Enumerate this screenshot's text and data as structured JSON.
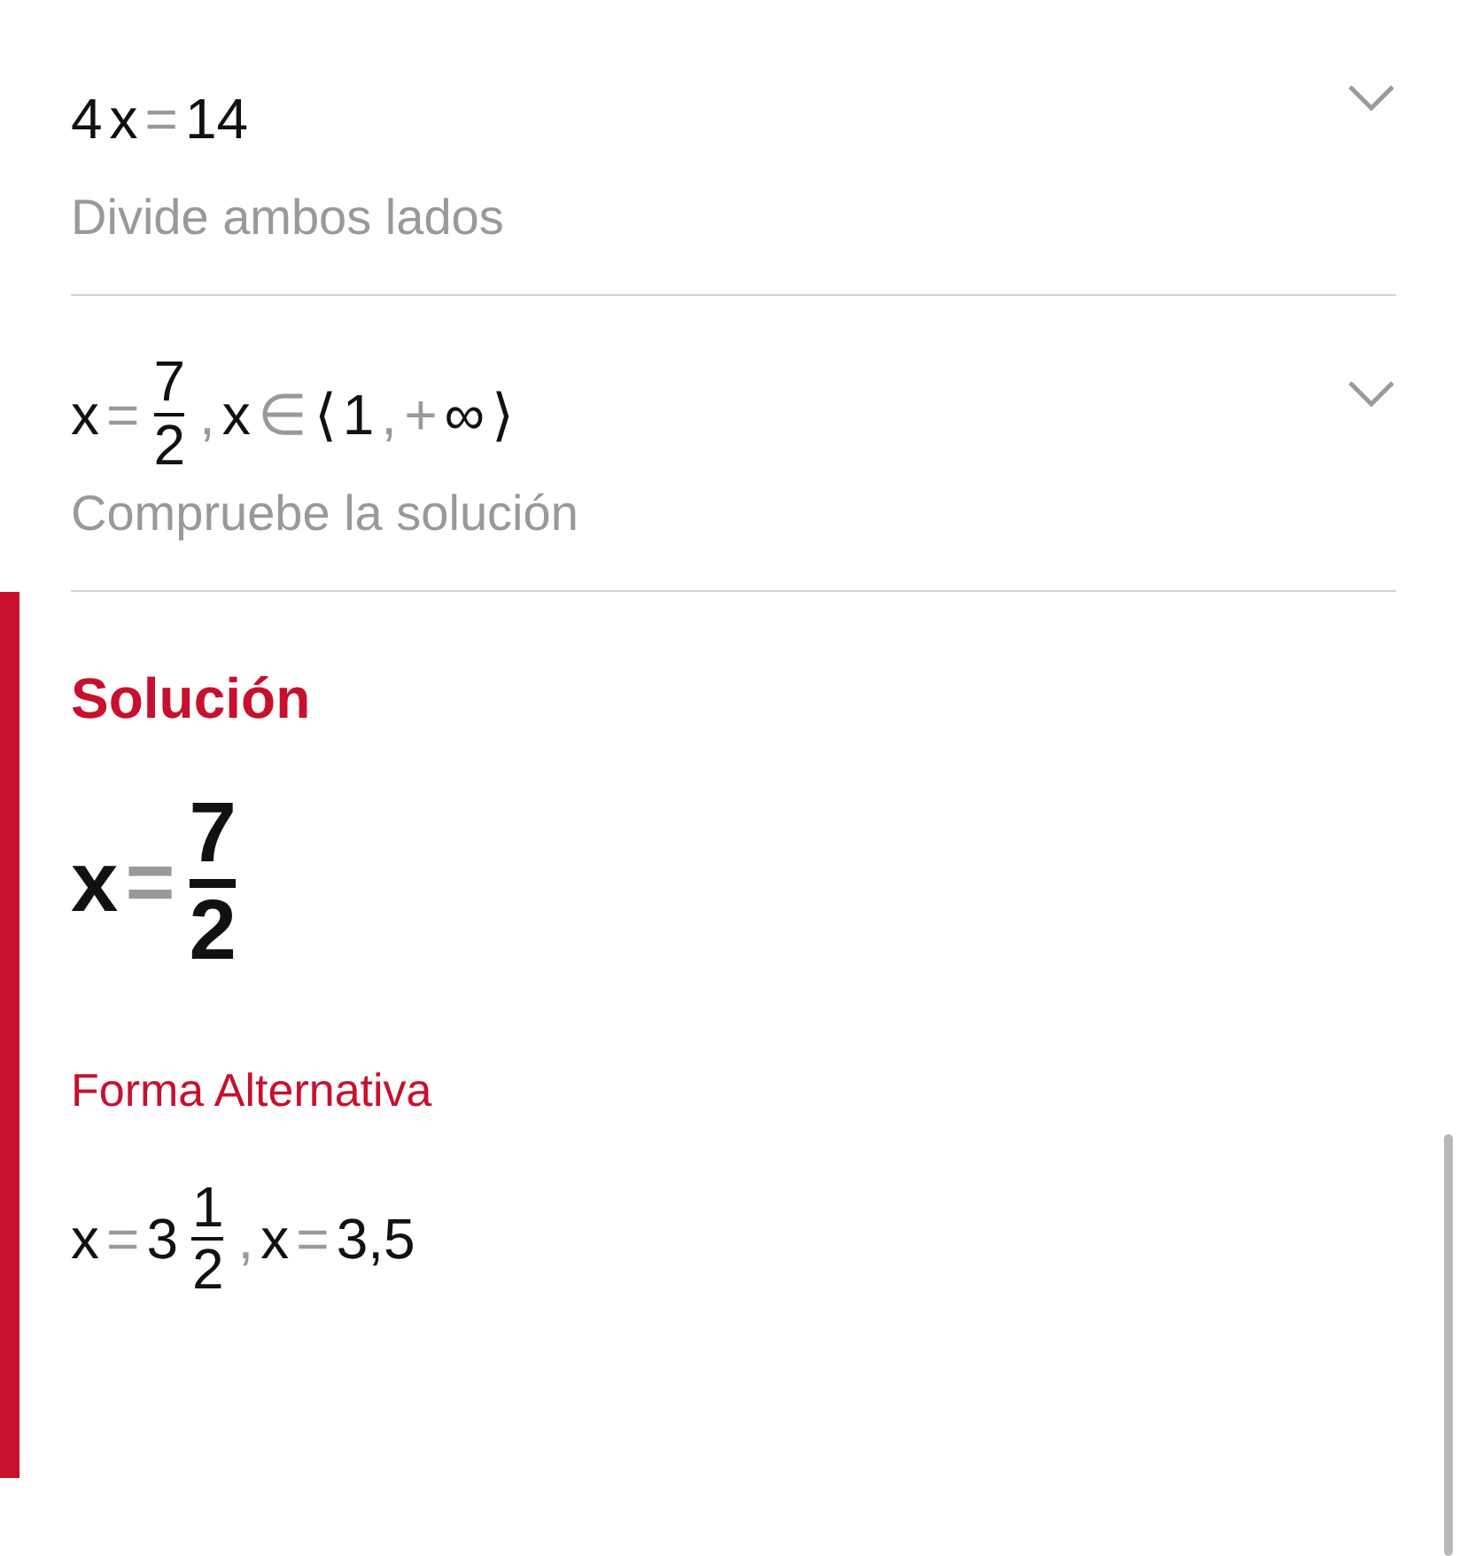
{
  "steps": [
    {
      "expression": [
        {
          "kind": "sym",
          "text": "4"
        },
        {
          "kind": "sym",
          "text": "x"
        },
        {
          "kind": "op",
          "text": "="
        },
        {
          "kind": "sym",
          "text": "14"
        }
      ],
      "description": "Divide ambos lados",
      "expanded": false
    },
    {
      "expression": [
        {
          "kind": "sym",
          "text": "x"
        },
        {
          "kind": "op",
          "text": "="
        },
        {
          "kind": "frac",
          "num": "7",
          "den": "2"
        },
        {
          "kind": "op",
          "text": ","
        },
        {
          "kind": "sym",
          "text": "x"
        },
        {
          "kind": "op",
          "text": "∈"
        },
        {
          "kind": "sym",
          "text": "⟨"
        },
        {
          "kind": "sym",
          "text": "1"
        },
        {
          "kind": "op",
          "text": ","
        },
        {
          "kind": "op",
          "text": "+"
        },
        {
          "kind": "sym",
          "text": "∞"
        },
        {
          "kind": "sym",
          "text": "⟩"
        }
      ],
      "description": "Compruebe la solución",
      "expanded": false
    }
  ],
  "solution": {
    "title": "Solución",
    "expression": [
      {
        "kind": "sym",
        "text": "x"
      },
      {
        "kind": "op",
        "text": "="
      },
      {
        "kind": "frac",
        "num": "7",
        "den": "2"
      }
    ],
    "alternative_title": "Forma Alternativa",
    "alternative": [
      {
        "kind": "sym",
        "text": "x"
      },
      {
        "kind": "op",
        "text": "="
      },
      {
        "kind": "sym",
        "text": "3"
      },
      {
        "kind": "frac",
        "num": "1",
        "den": "2"
      },
      {
        "kind": "op",
        "text": ","
      },
      {
        "kind": "sym",
        "text": "x"
      },
      {
        "kind": "op",
        "text": "="
      },
      {
        "kind": "sym",
        "text": "3,5"
      }
    ]
  }
}
